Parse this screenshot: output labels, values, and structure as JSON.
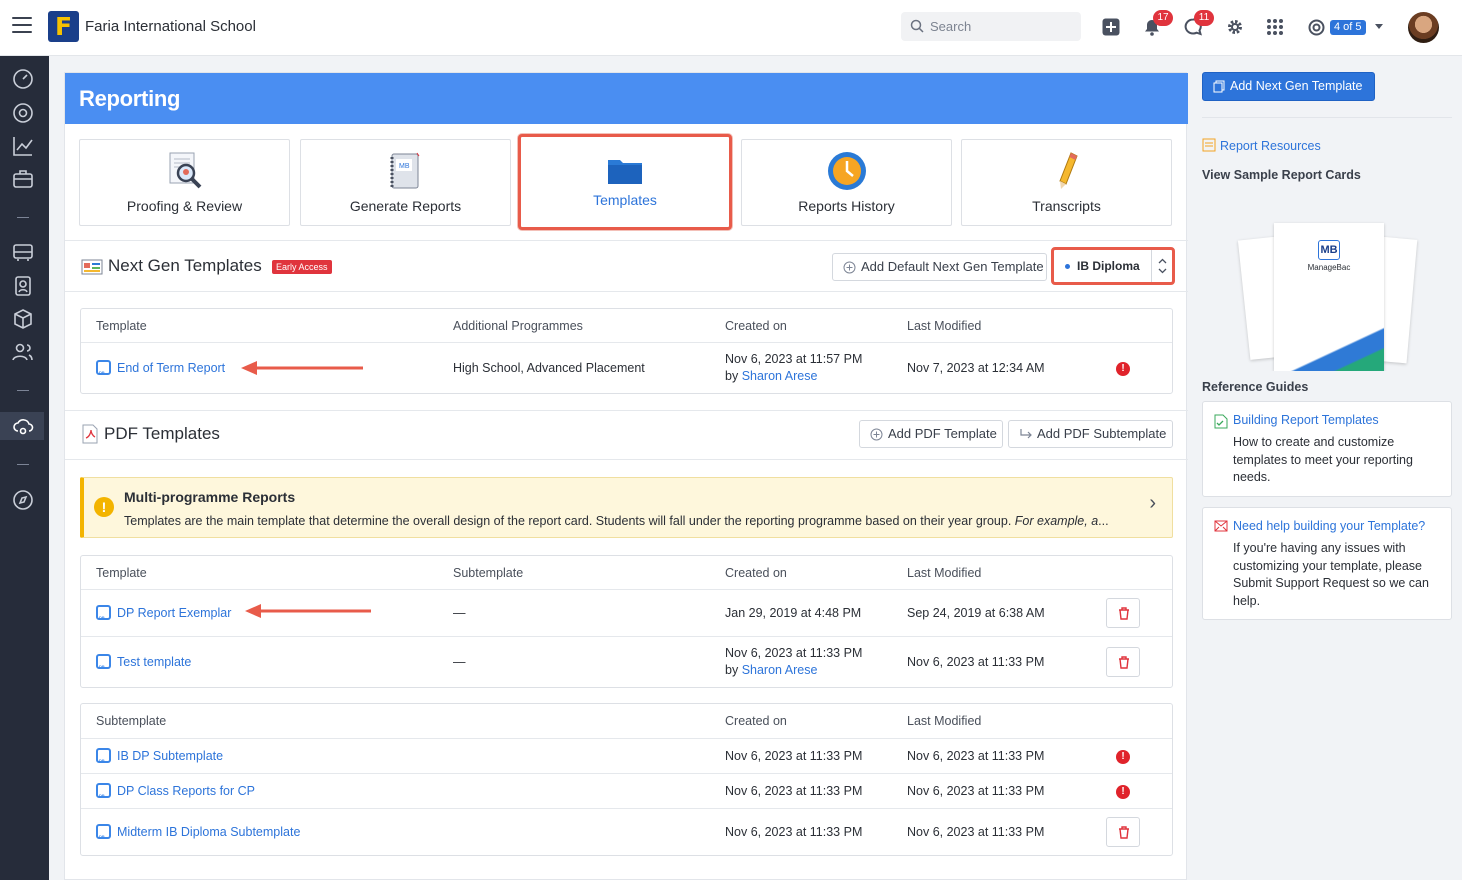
{
  "topbar": {
    "school_name": "Faria International School",
    "search_placeholder": "Search",
    "notifications_count": "17",
    "messages_count": "11",
    "pager_label": "4 of 5"
  },
  "page": {
    "title": "Reporting"
  },
  "tiles": [
    {
      "label": "Proofing & Review",
      "icon": "magnifier-document-icon"
    },
    {
      "label": "Generate Reports",
      "icon": "report-cards-book-icon"
    },
    {
      "label": "Templates",
      "icon": "folder-icon",
      "active": true
    },
    {
      "label": "Reports History",
      "icon": "clock-icon"
    },
    {
      "label": "Transcripts",
      "icon": "pencil-icon"
    }
  ],
  "next_gen": {
    "title": "Next Gen Templates",
    "badge": "Early Access",
    "add_default_label": "Add Default Next Gen Template",
    "programme_select": "IB Diploma",
    "columns": [
      "Template",
      "Additional Programmes",
      "Created on",
      "Last Modified"
    ],
    "rows": [
      {
        "name": "End of Term Report",
        "additional": "High School, Advanced Placement",
        "created": "Nov 6, 2023 at 11:57 PM",
        "created_by_prefix": "by",
        "created_by": "Sharon Arese",
        "modified": "Nov 7, 2023 at 12:34 AM",
        "status": "error"
      }
    ]
  },
  "pdf": {
    "title": "PDF Templates",
    "add_template_label": "Add PDF Template",
    "add_subtemplate_label": "Add PDF Subtemplate",
    "notice_title": "Multi-programme Reports",
    "notice_body": "Templates are the main template that determine the overall design of the report card. Students will fall under the reporting programme based on their year group.",
    "notice_italic": "For example, a",
    "columns": [
      "Template",
      "Subtemplate",
      "Created on",
      "Last Modified"
    ],
    "rows": [
      {
        "name": "DP Report Exemplar",
        "sub": "—",
        "created": "Jan 29, 2019 at 4:48 PM",
        "modified": "Sep 24, 2019 at 6:38 AM"
      },
      {
        "name": "Test template",
        "sub": "—",
        "created": "Nov 6, 2023 at 11:33 PM",
        "created_by_prefix": "by",
        "created_by": "Sharon Arese",
        "modified": "Nov 6, 2023 at 11:33 PM"
      }
    ],
    "sub_columns": [
      "Subtemplate",
      "Created on",
      "Last Modified"
    ],
    "sub_rows": [
      {
        "name": "IB DP Subtemplate",
        "created": "Nov 6, 2023 at 11:33 PM",
        "modified": "Nov 6, 2023 at 11:33 PM",
        "status": "error"
      },
      {
        "name": "DP Class Reports for CP",
        "created": "Nov 6, 2023 at 11:33 PM",
        "modified": "Nov 6, 2023 at 11:33 PM",
        "status": "error"
      },
      {
        "name": "Midterm IB Diploma Subtemplate",
        "created": "Nov 6, 2023 at 11:33 PM",
        "modified": "Nov 6, 2023 at 11:33 PM",
        "status": "delete"
      }
    ]
  },
  "right_panel": {
    "add_button": "Add Next Gen Template",
    "resources_link": "Report Resources",
    "sample_heading": "View Sample Report Cards",
    "preview_brand": "ManageBac",
    "reference_heading": "Reference Guides",
    "guides": [
      {
        "title": "Building Report Templates",
        "body": "How to create and customize templates to meet your reporting needs."
      },
      {
        "title": "Need help building your Template?",
        "body": "If you're having any issues with customizing your template, please Submit Support Request so we can help."
      }
    ]
  },
  "colors": {
    "accent": "#2d74da",
    "banner": "#4a8ef2",
    "sidebar": "#262c3a",
    "highlight": "#e85b4a",
    "error": "#e0232b",
    "notice": "#fef7dc"
  }
}
